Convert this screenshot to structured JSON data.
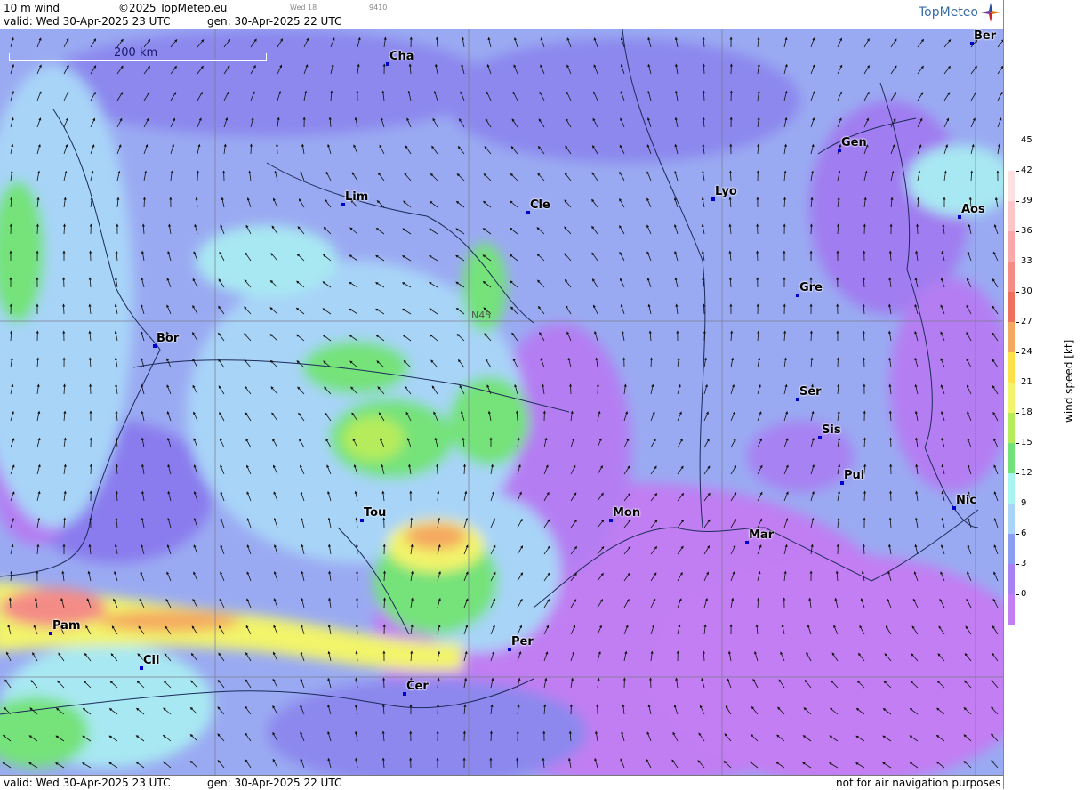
{
  "header": {
    "product": "10 m wind",
    "copyright": "©2025 TopMeteo.eu",
    "day_short": "Wed 18",
    "code": "9410",
    "valid": "valid:  Wed  30-Apr-2025  23 UTC",
    "generated": "gen: 30-Apr-2025 22 UTC"
  },
  "logo": "TopMeteo",
  "map": {
    "scale_label": "200 km",
    "latitude_label": "N45",
    "cities": [
      "Cha",
      "Lim",
      "Cle",
      "Lyo",
      "Gen",
      "Ber",
      "Aos",
      "Gre",
      "Bor",
      "Ser",
      "Sis",
      "Pui",
      "Nic",
      "Tou",
      "Mon",
      "Mar",
      "Pam",
      "Cil",
      "Per",
      "Cer"
    ]
  },
  "footer": {
    "valid": "valid:  Wed  30-Apr-2025  23 UTC",
    "generated": "gen: 30-Apr-2025 22 UTC",
    "note": "not for air navigation purposes"
  },
  "colorbar": {
    "title": "wind speed [kt]",
    "ticks": [
      "45",
      "42",
      "39",
      "36",
      "33",
      "30",
      "27",
      "24",
      "21",
      "18",
      "15",
      "12",
      "9",
      "6",
      "3",
      "0"
    ],
    "colors": [
      "#fff2f4",
      "#fde0e2",
      "#fbc6c8",
      "#f8a8a8",
      "#f48c86",
      "#ef705e",
      "#f5a860",
      "#fde04a",
      "#f2f46a",
      "#b6ec5c",
      "#74e27a",
      "#a8f4ef",
      "#a8d4f8",
      "#8a9ef2",
      "#a782f2",
      "#c27ef2"
    ]
  }
}
